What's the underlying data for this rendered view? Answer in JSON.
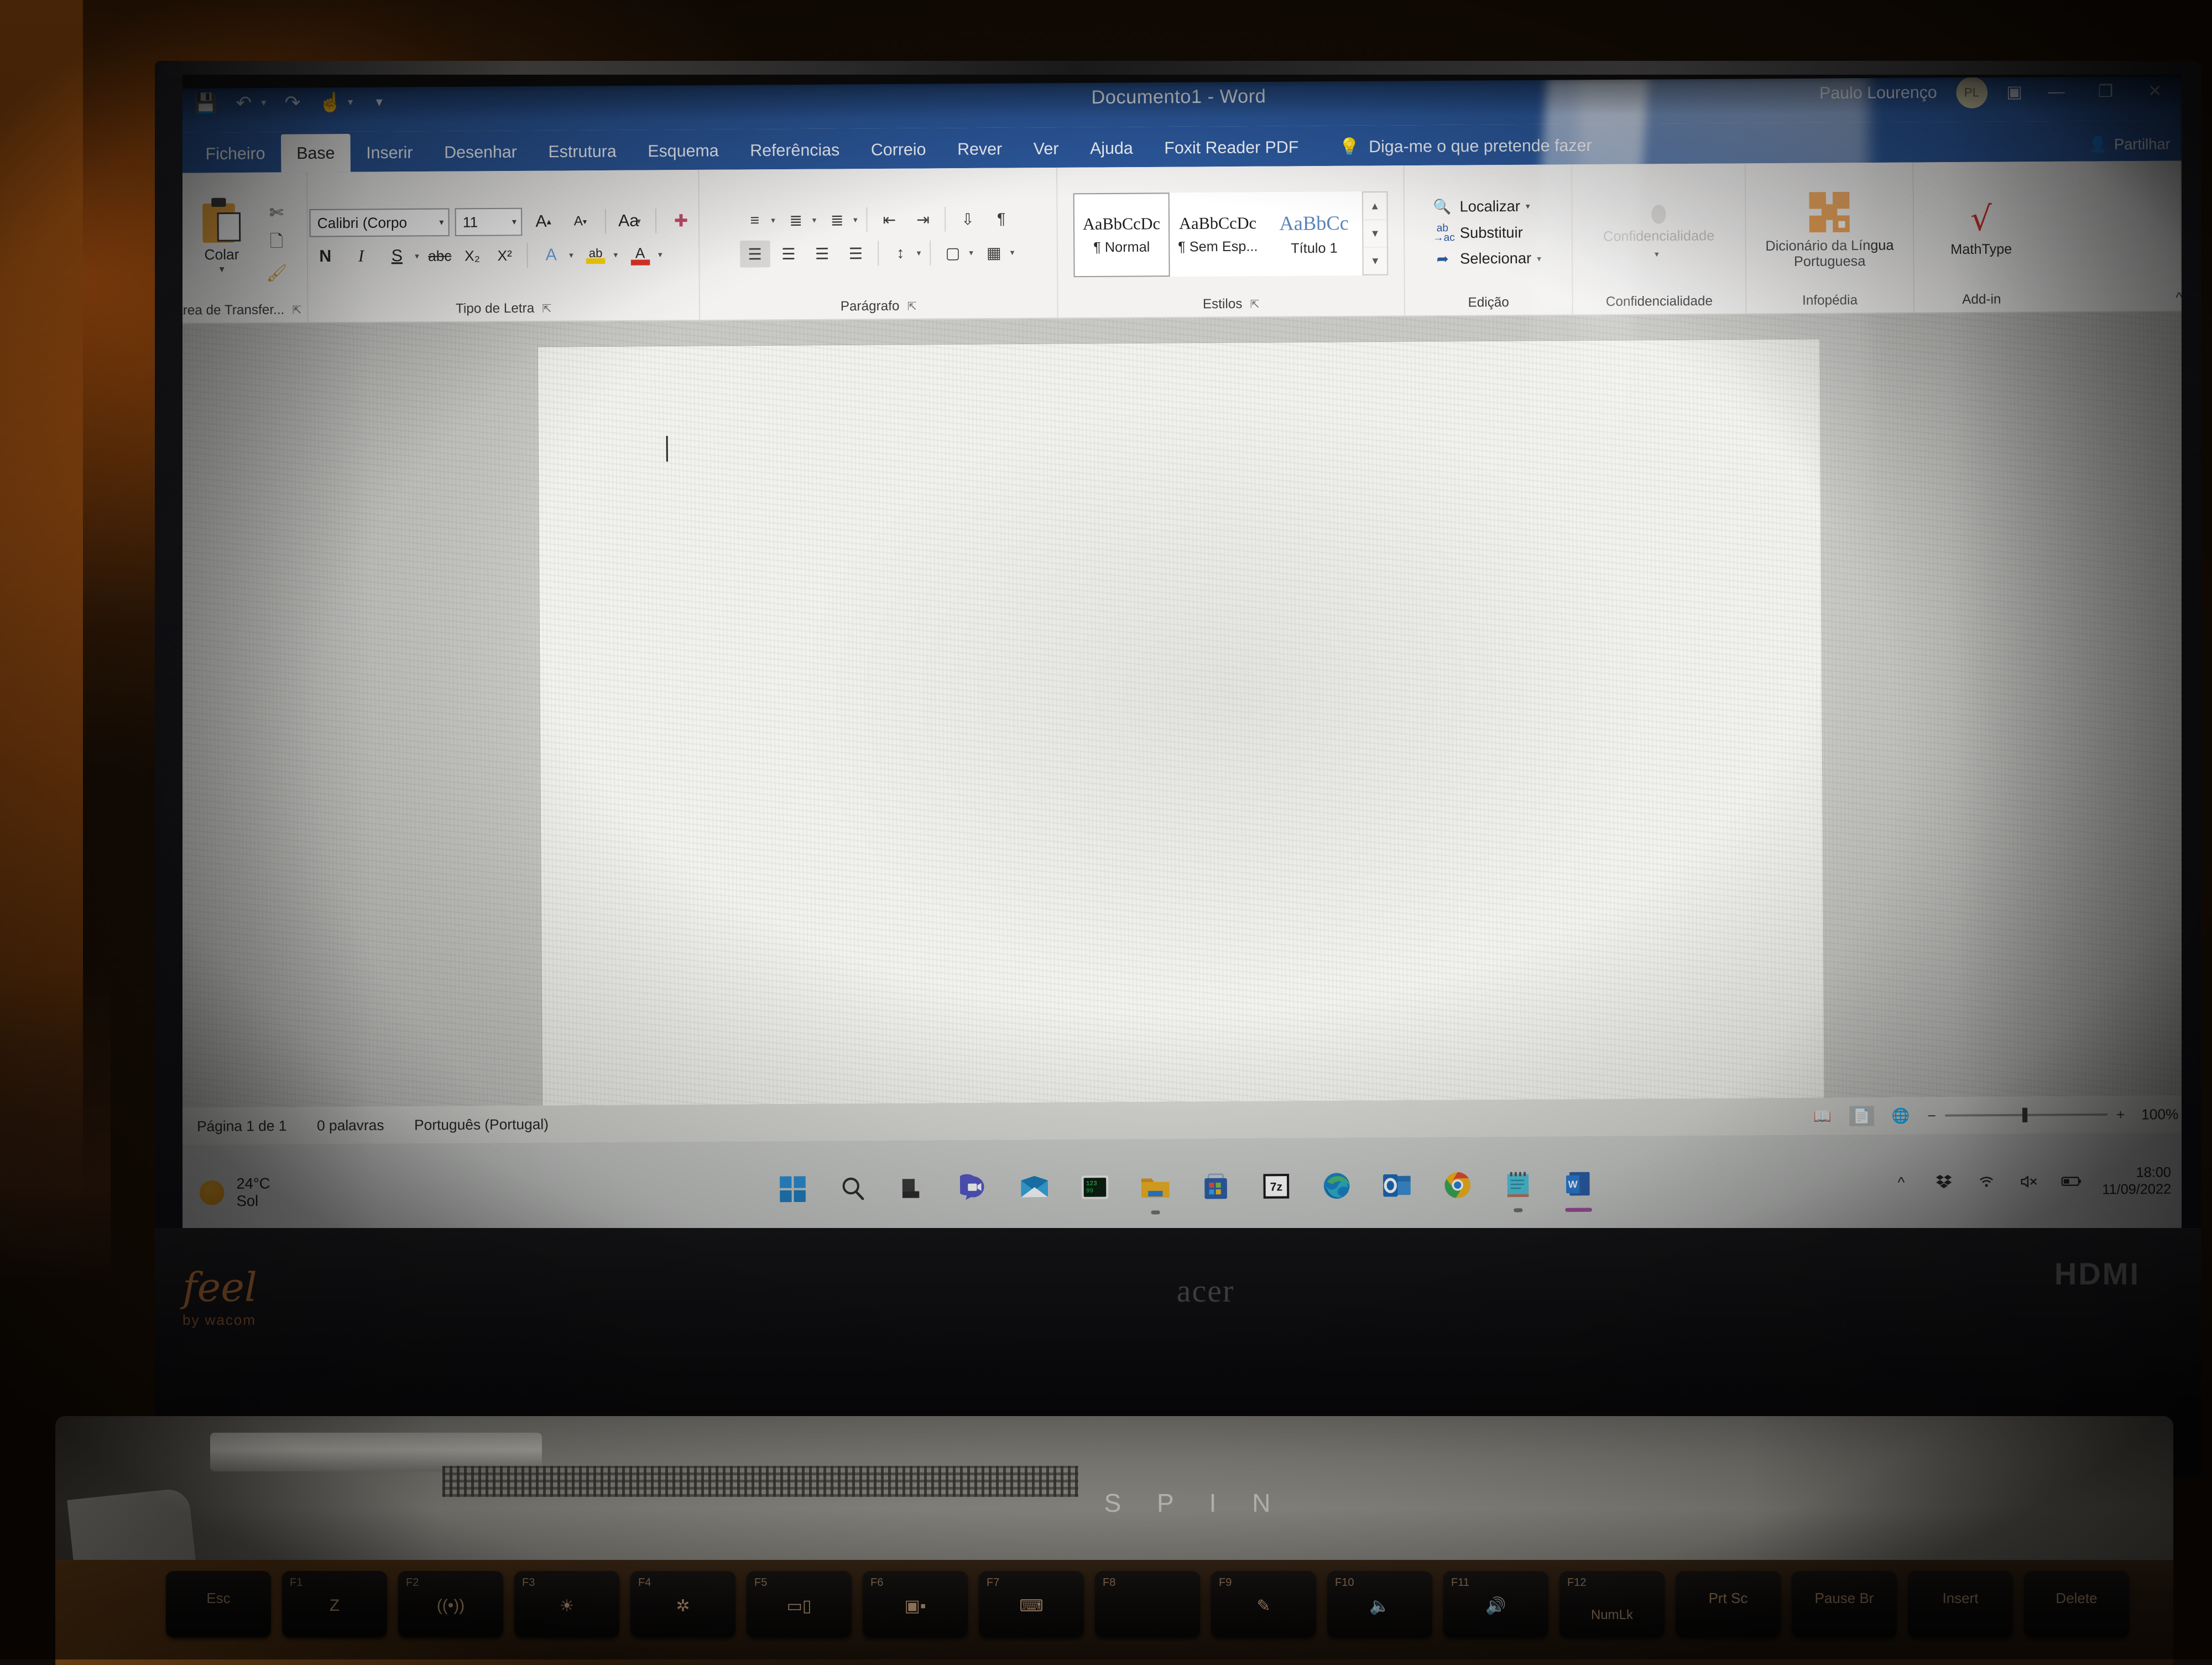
{
  "app": {
    "title": "Documento1  -  Word",
    "user": "Paulo Lourenço",
    "avatar_initials": "PL",
    "accent_color": "#2b579a"
  },
  "quick_access": {
    "save_icon": "save-icon",
    "undo_icon": "undo-icon",
    "redo_icon": "redo-icon",
    "touch_mode_icon": "touch-mode-icon",
    "customize_icon": "customize-qat-icon"
  },
  "window_controls": {
    "ribbon_display_icon": "ribbon-display-options-icon",
    "minimize": "—",
    "restore": "❐",
    "close": "✕"
  },
  "tabs": [
    {
      "label": "Ficheiro",
      "active": false
    },
    {
      "label": "Base",
      "active": true
    },
    {
      "label": "Inserir",
      "active": false
    },
    {
      "label": "Desenhar",
      "active": false
    },
    {
      "label": "Estrutura",
      "active": false
    },
    {
      "label": "Esquema",
      "active": false
    },
    {
      "label": "Referências",
      "active": false
    },
    {
      "label": "Correio",
      "active": false
    },
    {
      "label": "Rever",
      "active": false
    },
    {
      "label": "Ver",
      "active": false
    },
    {
      "label": "Ajuda",
      "active": false
    },
    {
      "label": "Foxit Reader PDF",
      "active": false
    }
  ],
  "tell_me": {
    "placeholder": "Diga-me o que pretende fazer",
    "icon": "lightbulb-icon"
  },
  "share": {
    "label": "Partilhar",
    "icon": "share-person-icon"
  },
  "ribbon": {
    "clipboard": {
      "group_label": "Área de Transfer...",
      "paste_label": "Colar",
      "cut_icon": "scissors-icon",
      "copy_icon": "copy-icon",
      "format_painter_icon": "format-painter-icon",
      "dialog_launcher": "⌐"
    },
    "font": {
      "group_label": "Tipo de Letra",
      "font_name": "Calibri (Corpo",
      "font_size": "11",
      "grow_font": "A",
      "shrink_font": "A",
      "change_case": "Aa",
      "clear_formatting_icon": "clear-formatting-icon",
      "bold": "N",
      "italic": "I",
      "underline": "S",
      "strikethrough": "abc",
      "subscript": "X₂",
      "superscript": "X²",
      "text_effects": "A",
      "highlight": "ab",
      "font_color": "A",
      "highlight_color": "#ffd400",
      "font_color_value": "#e03127",
      "dialog_launcher": "⌐"
    },
    "paragraph": {
      "group_label": "Parágrafo",
      "bullets_icon": "bullet-list-icon",
      "numbering_icon": "numbered-list-icon",
      "multilevel_icon": "multilevel-list-icon",
      "decrease_indent_icon": "decrease-indent-icon",
      "increase_indent_icon": "increase-indent-icon",
      "sort_icon": "sort-icon",
      "show_marks_icon": "show-paragraph-marks-icon",
      "align_left_icon": "align-left-icon",
      "align_center_icon": "align-center-icon",
      "align_right_icon": "align-right-icon",
      "justify_icon": "justify-icon",
      "line_spacing_icon": "line-spacing-icon",
      "shading_icon": "shading-icon",
      "borders_icon": "borders-icon",
      "dialog_launcher": "⌐"
    },
    "styles": {
      "group_label": "Estilos",
      "items": [
        {
          "sample": "AaBbCcDc",
          "name": "¶ Normal",
          "selected": true
        },
        {
          "sample": "AaBbCcDc",
          "name": "¶ Sem Esp...",
          "selected": false
        },
        {
          "sample": "AaBbCc",
          "name": "Título 1",
          "selected": false
        }
      ],
      "scroll_up": "▲",
      "scroll_down": "▼",
      "more": "▼",
      "dialog_launcher": "⌐"
    },
    "editing": {
      "group_label": "Edição",
      "items": [
        {
          "label": "Localizar",
          "icon": "search-icon",
          "caret": "▾"
        },
        {
          "label": "Substituir",
          "icon": "replace-icon",
          "caret": ""
        },
        {
          "label": "Selecionar",
          "icon": "select-cursor-icon",
          "caret": "▾"
        }
      ]
    },
    "confidentiality": {
      "group_label": "Confidencialidade",
      "button_label": "Confidencialidade",
      "icon": "sensitivity-icon",
      "caret": "▾"
    },
    "infopedia": {
      "group_label": "Infopédia",
      "button_label": "Dicionário da Língua Portuguesa",
      "icon": "infopedia-logo-icon",
      "icon_color": "#ef8b22"
    },
    "addin": {
      "group_label": "Add-in",
      "button_label": "MathType",
      "icon": "mathtype-radical-icon",
      "icon_color": "#d0342c"
    },
    "collapse_ribbon": "collapse-ribbon-icon"
  },
  "status_bar": {
    "page": "Página 1 de 1",
    "words": "0 palavras",
    "language": "Português (Portugal)",
    "views": [
      {
        "icon": "read-mode-icon",
        "selected": false
      },
      {
        "icon": "print-layout-icon",
        "selected": true
      },
      {
        "icon": "web-layout-icon",
        "selected": false
      }
    ],
    "zoom_out": "−",
    "zoom_in": "+",
    "zoom_level": "100%"
  },
  "taskbar": {
    "weather": {
      "temperature": "24°C",
      "condition": "Sol",
      "icon": "sun-icon"
    },
    "icons": [
      {
        "name": "windows-start-icon",
        "running": false
      },
      {
        "name": "search-icon",
        "running": false
      },
      {
        "name": "task-view-icon",
        "running": false
      },
      {
        "name": "teams-chat-icon",
        "running": false
      },
      {
        "name": "mail-icon",
        "running": false
      },
      {
        "name": "matrix-terminal-icon",
        "running": false
      },
      {
        "name": "file-explorer-icon",
        "running": true
      },
      {
        "name": "microsoft-store-icon",
        "running": false
      },
      {
        "name": "7zip-icon",
        "running": false
      },
      {
        "name": "microsoft-edge-icon",
        "running": false
      },
      {
        "name": "outlook-icon",
        "running": false
      },
      {
        "name": "google-chrome-icon",
        "running": true
      },
      {
        "name": "sticky-notes-icon",
        "running": true
      },
      {
        "name": "microsoft-word-icon",
        "running": true,
        "active": true
      }
    ],
    "tray": [
      {
        "name": "show-hidden-icons-chevron-icon",
        "glyph": "^"
      },
      {
        "name": "dropbox-icon",
        "glyph": ""
      },
      {
        "name": "wifi-icon",
        "glyph": ""
      },
      {
        "name": "volume-muted-icon",
        "glyph": ""
      },
      {
        "name": "battery-icon",
        "glyph": ""
      }
    ],
    "clock": {
      "time": "18:00",
      "date": "11/09/2022"
    }
  },
  "hardware": {
    "brand": "acer",
    "model": "S P I N",
    "port_label": "HDMI",
    "stylus_brand_main": "feel",
    "stylus_brand_sub": "by wacom",
    "keys": [
      {
        "label": "Esc",
        "fn": "",
        "glyph": ""
      },
      {
        "label": "",
        "fn": "F1",
        "glyph": "Z"
      },
      {
        "label": "",
        "fn": "F2",
        "glyph": "((•))"
      },
      {
        "label": "",
        "fn": "F3",
        "glyph": "☀"
      },
      {
        "label": "",
        "fn": "F4",
        "glyph": "✲"
      },
      {
        "label": "",
        "fn": "F5",
        "glyph": "▭▯"
      },
      {
        "label": "",
        "fn": "F6",
        "glyph": "▣▪"
      },
      {
        "label": "",
        "fn": "F7",
        "glyph": "⌨"
      },
      {
        "label": "",
        "fn": "F8",
        "glyph": ""
      },
      {
        "label": "",
        "fn": "F9",
        "glyph": "✎"
      },
      {
        "label": "",
        "fn": "F10",
        "glyph": "🔈"
      },
      {
        "label": "",
        "fn": "F11",
        "glyph": "🔊"
      },
      {
        "label": "NumLk",
        "fn": "F12",
        "glyph": ""
      },
      {
        "label": "Prt Sc",
        "fn": "",
        "glyph": ""
      },
      {
        "label": "Pause Br",
        "fn": "",
        "glyph": ""
      },
      {
        "label": "Insert",
        "fn": "",
        "glyph": ""
      },
      {
        "label": "Delete",
        "fn": "",
        "glyph": ""
      }
    ]
  }
}
